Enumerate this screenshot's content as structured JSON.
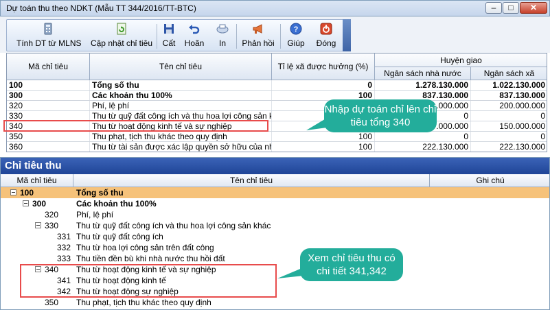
{
  "window": {
    "title": "Dự toán thu theo NDKT (Mẫu TT 344/2016/TT-BTC)"
  },
  "toolbar": {
    "tinh_dt": "Tính DT từ MLNS",
    "cap_nhat": "Cập nhật chỉ tiêu",
    "cat": "Cất",
    "hoan": "Hoãn",
    "in": "In",
    "phan_hoi": "Phản hồi",
    "giup": "Giúp",
    "dong": "Đóng"
  },
  "grid1": {
    "headers": {
      "code": "Mã chỉ tiêu",
      "name": "Tên chỉ tiêu",
      "ratio": "Tỉ lệ xã được hưởng (%)",
      "group": "Huyện giao",
      "ns_nha_nuoc": "Ngân sách nhà nước",
      "ns_xa": "Ngân sách xã"
    },
    "rows": [
      {
        "code": "100",
        "name": "Tổng số thu",
        "ratio": "0",
        "nn": "1.278.130.000",
        "xa": "1.022.130.000"
      },
      {
        "code": "300",
        "name": "Các khoản thu 100%",
        "ratio": "100",
        "nn": "837.130.000",
        "xa": "837.130.000"
      },
      {
        "code": "320",
        "name": "Phí, lệ phí",
        "ratio": "",
        "nn": ".000.000",
        "xa": "200.000.000"
      },
      {
        "code": "330",
        "name": "Thu từ quỹ đất công ích và thu hoa lợi công sản k...",
        "ratio": "",
        "nn": "0",
        "xa": "0"
      },
      {
        "code": "340",
        "name": "Thu từ hoạt động kinh tế và sự nghiệp",
        "ratio": "",
        "nn": ".000.000",
        "xa": "150.000.000"
      },
      {
        "code": "350",
        "name": "Thu phạt, tịch thu khác theo quy định",
        "ratio": "100",
        "nn": "0",
        "xa": "0"
      },
      {
        "code": "360",
        "name": "Thu từ tài sản được xác lập quyền sở hữu của nhà...",
        "ratio": "100",
        "nn": "222.130.000",
        "xa": "222.130.000"
      }
    ]
  },
  "callouts": {
    "first": "Nhập dự toán chỉ lên chỉ tiêu tổng 340",
    "second": "Xem chỉ tiêu thu có chi tiết 341,342"
  },
  "panel2": {
    "title": "Chỉ tiêu thu",
    "headers": {
      "code": "Mã chỉ tiêu",
      "name": "Tên chỉ tiêu",
      "note": "Ghi chú"
    },
    "rows": [
      {
        "code": "100",
        "name": "Tổng số thu"
      },
      {
        "code": "300",
        "name": "Các khoản thu 100%"
      },
      {
        "code": "320",
        "name": "Phí, lệ phí"
      },
      {
        "code": "330",
        "name": "Thu từ quỹ đất công ích và thu hoa lợi công sản khác"
      },
      {
        "code": "331",
        "name": "Thu từ quỹ đất công ích"
      },
      {
        "code": "332",
        "name": "Thu từ hoa lợi công sản trên đất công"
      },
      {
        "code": "333",
        "name": "Thu tiền đền bù khi nhà nước thu hồi đất"
      },
      {
        "code": "340",
        "name": "Thu từ hoạt động kinh tế và sự nghiệp"
      },
      {
        "code": "341",
        "name": "Thu từ hoạt động kinh tế"
      },
      {
        "code": "342",
        "name": "Thu từ hoạt động sự nghiệp"
      },
      {
        "code": "350",
        "name": "Thu phạt, tịch thu khác theo quy định"
      }
    ]
  }
}
